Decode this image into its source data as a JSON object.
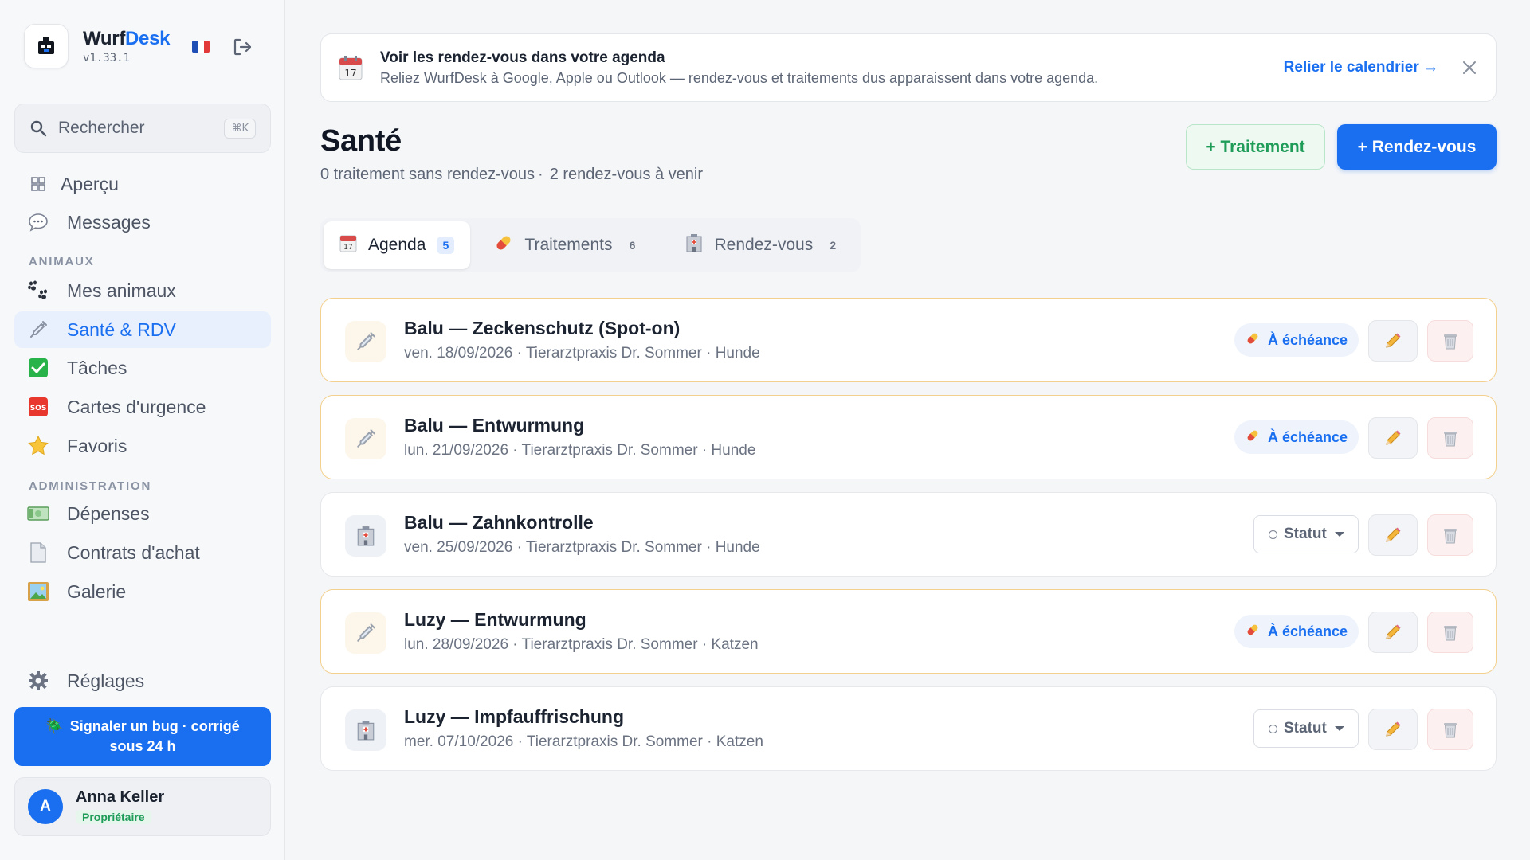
{
  "brand": {
    "name_part1": "Wurf",
    "name_part2": "Desk",
    "version": "v1.33.1"
  },
  "search": {
    "placeholder": "Rechercher",
    "shortcut": "⌘K"
  },
  "nav": {
    "apercu": "Aperçu",
    "messages": "Messages",
    "section_animaux": "ANIMAUX",
    "mes_animaux": "Mes animaux",
    "sante": "Santé & RDV",
    "taches": "Tâches",
    "cartes": "Cartes d'urgence",
    "favoris": "Favoris",
    "section_admin": "ADMINISTRATION",
    "depenses": "Dépenses",
    "contrats": "Contrats d'achat",
    "galerie": "Galerie",
    "reglages": "Réglages"
  },
  "bug_button": {
    "line1": "Signaler un bug · corrigé",
    "line2": "sous 24 h"
  },
  "user": {
    "initial": "A",
    "name": "Anna Keller",
    "role": "Propriétaire"
  },
  "banner": {
    "title": "Voir les rendez-vous dans votre agenda",
    "subtitle": "Reliez WurfDesk à Google, Apple ou Outlook — rendez-vous et traitements dus apparaissent dans votre agenda.",
    "link": "Relier le calendrier →"
  },
  "page": {
    "title": "Santé",
    "sub_part1": "0 traitement sans rendez-vous",
    "sub_sep": "·",
    "sub_part2": "2 rendez-vous à venir",
    "btn_treatment": "+ Traitement",
    "btn_appointment": "+ Rendez-vous"
  },
  "tabs": [
    {
      "label": "Agenda",
      "count": "5"
    },
    {
      "label": "Traitements",
      "count": "6"
    },
    {
      "label": "Rendez-vous",
      "count": "2"
    }
  ],
  "labels": {
    "due": "À échéance",
    "status": "Statut"
  },
  "entries": [
    {
      "title": "Balu — Zeckenschutz (Spot-on)",
      "meta": "ven. 18/09/2026 · Tierarztpraxis Dr. Sommer · Hunde"
    },
    {
      "title": "Balu — Entwurmung",
      "meta": "lun. 21/09/2026 · Tierarztpraxis Dr. Sommer · Hunde"
    },
    {
      "title": "Balu — Zahnkontrolle",
      "meta": "ven. 25/09/2026 · Tierarztpraxis Dr. Sommer · Hunde"
    },
    {
      "title": "Luzy — Entwurmung",
      "meta": "lun. 28/09/2026 · Tierarztpraxis Dr. Sommer · Katzen"
    },
    {
      "title": "Luzy — Impfauffrischung",
      "meta": "mer. 07/10/2026 · Tierarztpraxis Dr. Sommer · Katzen"
    }
  ],
  "colors": {
    "accent": "#1a6ff0",
    "success": "#1e9c58",
    "due_border": "#f3d08e"
  }
}
